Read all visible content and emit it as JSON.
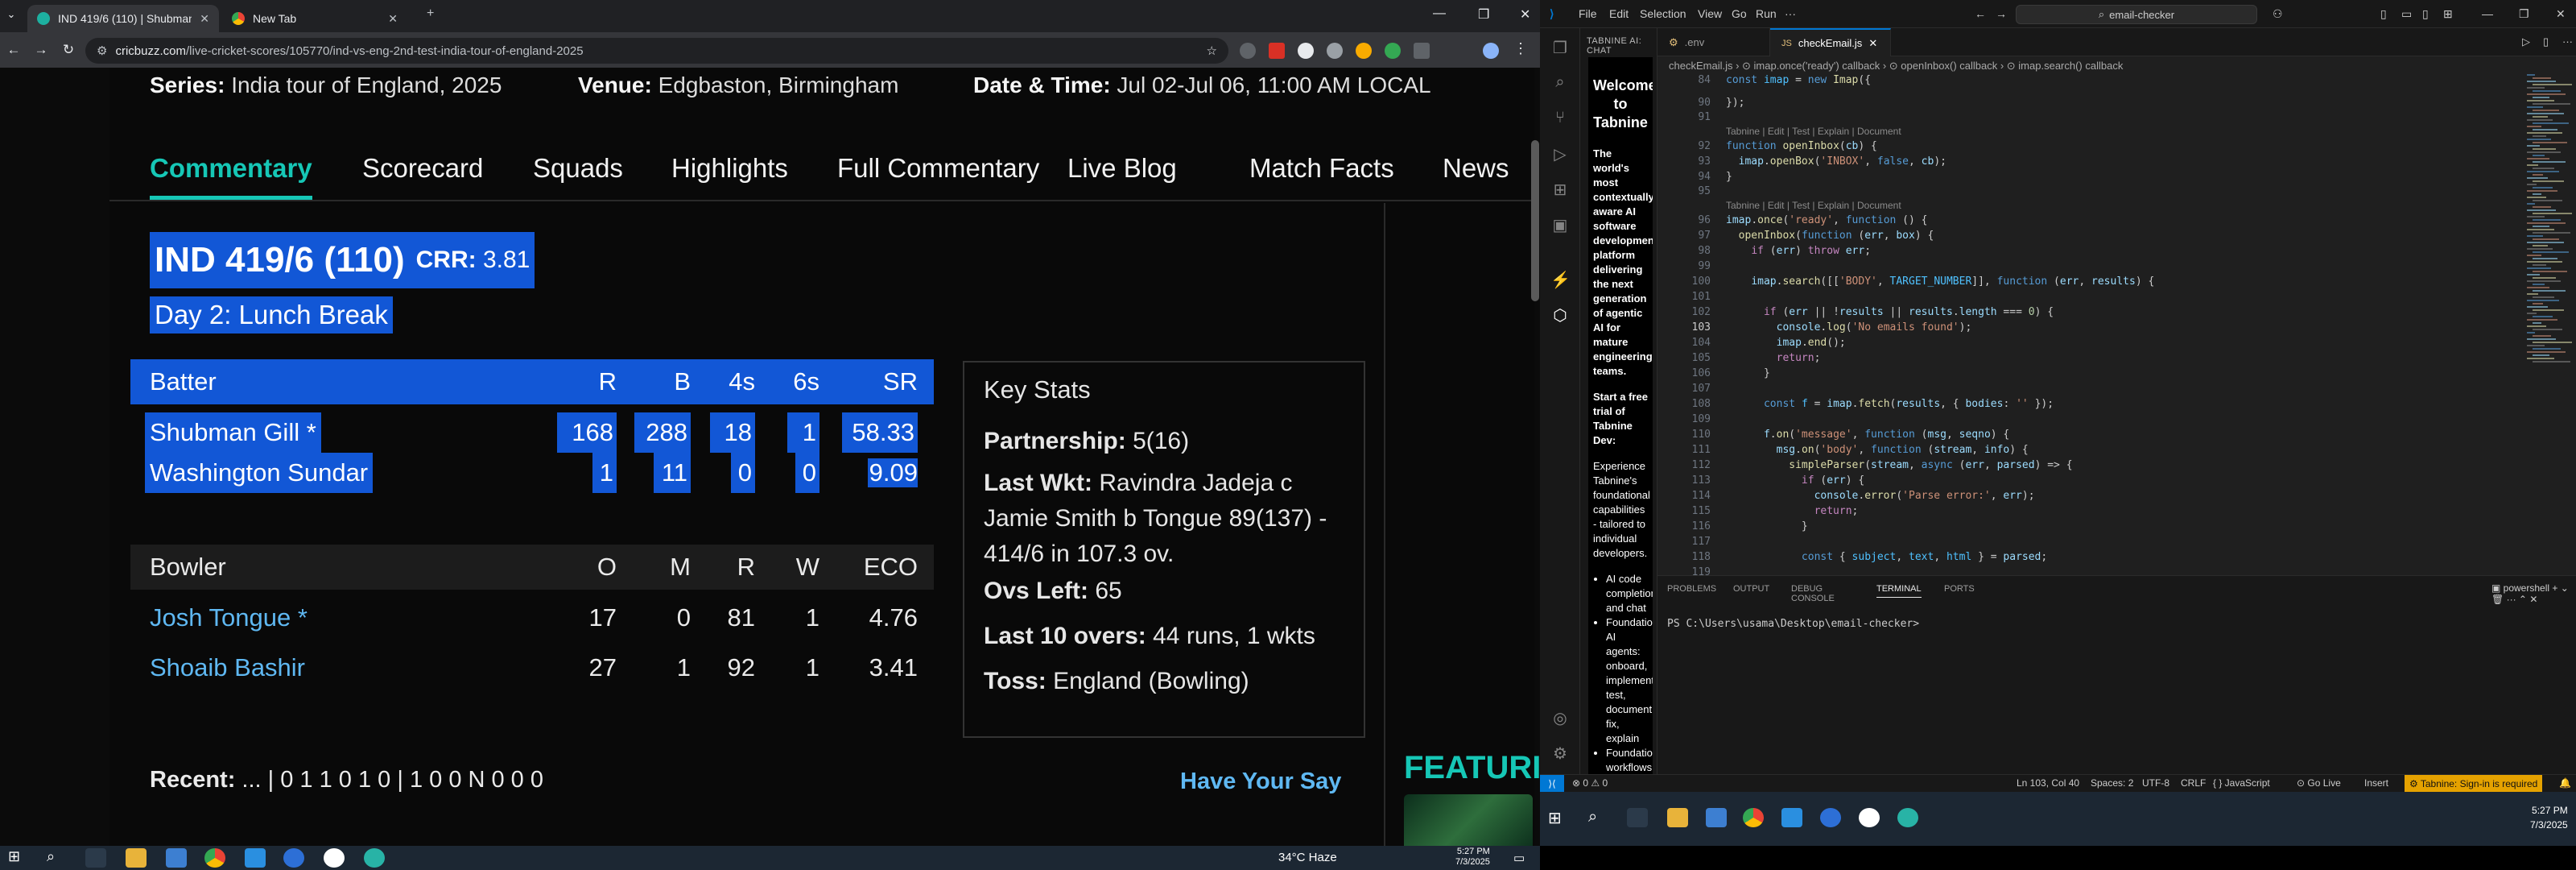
{
  "chrome": {
    "tabs": [
      {
        "title": "IND 419/6 (110) | Shubman Gill",
        "active": true
      },
      {
        "title": "New Tab",
        "active": false
      }
    ],
    "url_host": "cricbuzz.com",
    "url_path": "/live-cricket-scores/105770/ind-vs-eng-2nd-test-india-tour-of-england-2025"
  },
  "match": {
    "series_label": "Series:",
    "series": "India tour of England, 2025",
    "venue_label": "Venue:",
    "venue": "Edgbaston, Birmingham",
    "datetime_label": "Date & Time:",
    "datetime": "Jul 02-Jul 06, 11:00 AM LOCAL",
    "tabs": [
      "Commentary",
      "Scorecard",
      "Squads",
      "Highlights",
      "Full Commentary",
      "Live Blog",
      "Match Facts",
      "News"
    ],
    "score": "IND 419/6 (110)",
    "crr_label": "CRR:",
    "crr": "3.81",
    "status": "Day 2: Lunch Break"
  },
  "batting": {
    "headers": [
      "Batter",
      "R",
      "B",
      "4s",
      "6s",
      "SR"
    ],
    "rows": [
      {
        "name": "Shubman Gill *",
        "r": "168",
        "b": "288",
        "fours": "18",
        "sixes": "1",
        "sr": "58.33"
      },
      {
        "name": "Washington Sundar",
        "r": "1",
        "b": "11",
        "fours": "0",
        "sixes": "0",
        "sr": "9.09"
      }
    ]
  },
  "bowling": {
    "headers": [
      "Bowler",
      "O",
      "M",
      "R",
      "W",
      "ECO"
    ],
    "rows": [
      {
        "name": "Josh Tongue *",
        "o": "17",
        "m": "0",
        "r": "81",
        "w": "1",
        "eco": "4.76"
      },
      {
        "name": "Shoaib Bashir",
        "o": "27",
        "m": "1",
        "r": "92",
        "w": "1",
        "eco": "3.41"
      }
    ]
  },
  "key_stats": {
    "title": "Key Stats",
    "partnership_label": "Partnership:",
    "partnership": "5(16)",
    "last_wkt_label": "Last Wkt:",
    "last_wkt": "Ravindra Jadeja c Jamie Smith b Tongue 89(137) - 414/6 in 107.3 ov.",
    "ovs_left_label": "Ovs Left:",
    "ovs_left": "65",
    "last10_label": "Last 10 overs:",
    "last10": "44 runs, 1 wkts",
    "toss_label": "Toss:",
    "toss": "England (Bowling)"
  },
  "recent_label": "Recent:",
  "recent": "... | 0 1 1 0 1 0 | 1 0 0 N 0 0 0",
  "have_your_say": "Have Your Say",
  "featured": "FEATURI",
  "taskbar_left": {
    "weather": "34°C  Haze",
    "time": "5:27 PM",
    "date": "7/3/2025"
  },
  "vscode": {
    "menu": [
      "File",
      "Edit",
      "Selection",
      "View",
      "Go",
      "Run",
      "···"
    ],
    "search": "email-checker",
    "side_header": "TABNINE AI: CHAT",
    "tabnine": {
      "title": "Welcome to Tabnine",
      "intro": "The world's most contextually aware AI software development platform delivering the next generation of agentic AI for mature engineering teams.",
      "trial": "Start a free trial of Tabnine Dev:",
      "experience": "Experience Tabnine's foundational capabilities - tailored to individual developers.",
      "bullets": [
        "AI code completions and chat",
        "Foundational AI agents: onboard, implement, test, document, fix, explain",
        "Foundational workflows: custom"
      ]
    },
    "tabs": [
      {
        "name": ".env",
        "active": false
      },
      {
        "name": "checkEmail.js",
        "active": true
      }
    ],
    "breadcrumb": "checkEmail.js › ⊙ imap.once('ready') callback › ⊙ openInbox() callback › ⊙ imap.search() callback",
    "lens": "Tabnine | Edit | Test | Explain | Document",
    "line_numbers": [
      "84",
      "90",
      "91",
      "",
      "92",
      "93",
      "94",
      "95",
      "",
      "96",
      "97",
      "98",
      "99",
      "100",
      "101",
      "102",
      "103",
      "104",
      "105",
      "106",
      "107",
      "108",
      "109",
      "110",
      "111",
      "112",
      "113",
      "114",
      "115",
      "116",
      "117",
      "118",
      "119"
    ],
    "panel_tabs": [
      "PROBLEMS",
      "OUTPUT",
      "DEBUG CONSOLE",
      "TERMINAL",
      "PORTS"
    ],
    "terminal": "PS C:\\Users\\usama\\Desktop\\email-checker>",
    "shell": "powershell",
    "status": {
      "errors": "⊗ 0 ⚠ 0",
      "position": "Ln 103, Col 40",
      "spaces": "Spaces: 2",
      "encoding": "UTF-8",
      "eol": "CRLF",
      "lang": "{ } JavaScript",
      "golive": "Go Live",
      "insert": "Insert",
      "tabnine": "⚙ Tabnine: Sign-in is required"
    }
  },
  "taskbar_right": {
    "time": "5:27 PM",
    "date": "7/3/2025"
  }
}
